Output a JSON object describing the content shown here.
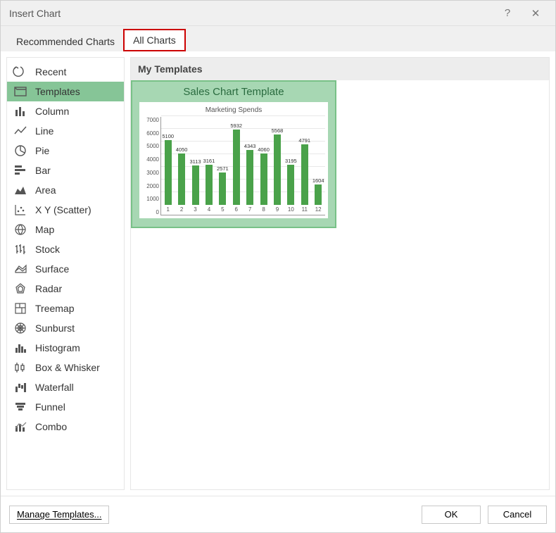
{
  "titlebar": {
    "title": "Insert Chart",
    "help": "?",
    "close": "✕"
  },
  "tabs": {
    "recommended": "Recommended Charts",
    "all": "All Charts"
  },
  "sidebar": {
    "items": [
      {
        "id": "recent",
        "label": "Recent"
      },
      {
        "id": "templates",
        "label": "Templates"
      },
      {
        "id": "column",
        "label": "Column"
      },
      {
        "id": "line",
        "label": "Line"
      },
      {
        "id": "pie",
        "label": "Pie"
      },
      {
        "id": "bar",
        "label": "Bar"
      },
      {
        "id": "area",
        "label": "Area"
      },
      {
        "id": "scatter",
        "label": "X Y (Scatter)"
      },
      {
        "id": "map",
        "label": "Map"
      },
      {
        "id": "stock",
        "label": "Stock"
      },
      {
        "id": "surface",
        "label": "Surface"
      },
      {
        "id": "radar",
        "label": "Radar"
      },
      {
        "id": "treemap",
        "label": "Treemap"
      },
      {
        "id": "sunburst",
        "label": "Sunburst"
      },
      {
        "id": "histogram",
        "label": "Histogram"
      },
      {
        "id": "boxwhisker",
        "label": "Box & Whisker"
      },
      {
        "id": "waterfall",
        "label": "Waterfall"
      },
      {
        "id": "funnel",
        "label": "Funnel"
      },
      {
        "id": "combo",
        "label": "Combo"
      }
    ],
    "selected": "templates"
  },
  "content": {
    "heading": "My Templates",
    "template_title": "Sales Chart Template",
    "chart_subtitle": "Marketing Spends"
  },
  "footer": {
    "manage": "Manage Templates...",
    "ok": "OK",
    "cancel": "Cancel"
  },
  "colors": {
    "select_bg": "#86c597",
    "accent_border": "#78c187",
    "accent_bg": "#a7d7b3",
    "bar": "#4aa24a",
    "title_text": "#2a6b3f",
    "highlight_box": "#c00"
  },
  "chart_data": {
    "type": "bar",
    "title": "Sales Chart Template",
    "subtitle": "Marketing Spends",
    "xlabel": "",
    "ylabel": "",
    "ylim": [
      0,
      7000
    ],
    "ytick_step": 1000,
    "yticks": [
      0,
      1000,
      2000,
      3000,
      4000,
      5000,
      6000,
      7000
    ],
    "categories": [
      "1",
      "2",
      "3",
      "4",
      "5",
      "6",
      "7",
      "8",
      "9",
      "10",
      "11",
      "12"
    ],
    "values": [
      5100,
      4050,
      3113,
      3161,
      2571,
      5932,
      4343,
      4060,
      5568,
      3195,
      4791,
      1604
    ],
    "data_labels": true,
    "legend": false,
    "grid": {
      "y": true,
      "x": false
    },
    "series_color": "#4aa24a"
  }
}
